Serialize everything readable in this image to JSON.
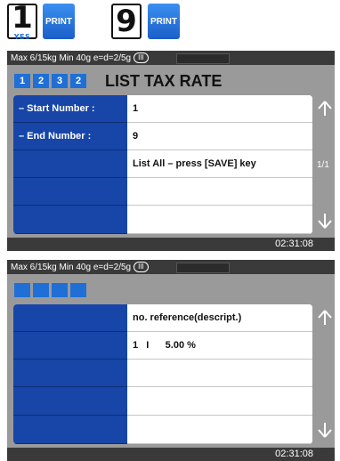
{
  "keys": {
    "key1": {
      "digit": "1",
      "sub": "YES"
    },
    "print1": "PRINT",
    "key9": {
      "digit": "9"
    },
    "print2": "PRINT"
  },
  "panel1": {
    "status": "Max 6/15kg Min 40g e=d=2/5g",
    "status_ring": "III",
    "steps": [
      "1",
      "2",
      "3",
      "2"
    ],
    "title": "LIST TAX RATE",
    "rows": [
      {
        "label": "– Start Number :",
        "value": "1"
      },
      {
        "label": "– End Number   :",
        "value": "9"
      },
      {
        "label": "",
        "value": "List All – press [SAVE] key"
      },
      {
        "label": "",
        "value": ""
      },
      {
        "label": "",
        "value": ""
      }
    ],
    "up_icon": "arrow-up-icon",
    "down_icon": "arrow-down-icon",
    "page": "1/1",
    "time": "02:31:08"
  },
  "panel2": {
    "status": "Max 6/15kg Min 40g e=d=2/5g",
    "status_ring": "III",
    "rows": [
      {
        "label": "",
        "value": "no. reference(descript.)"
      },
      {
        "label": "",
        "value": "1   I      5.00 %"
      },
      {
        "label": "",
        "value": ""
      },
      {
        "label": "",
        "value": ""
      },
      {
        "label": "",
        "value": ""
      }
    ],
    "time": "02:31:08"
  },
  "colors": {
    "accent": "#1f6fd6",
    "label_bg": "#1746a8",
    "panel_bg": "#9a9a9a",
    "statusbar": "#3a3a3a"
  }
}
